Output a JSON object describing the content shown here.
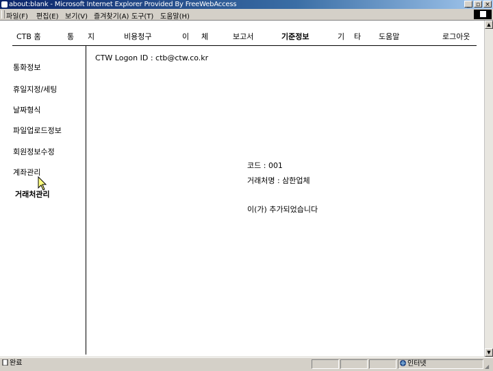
{
  "window": {
    "title": "about:blank - Microsoft Internet Explorer Provided By FreeWebAccess",
    "controls": {
      "minimize": "_",
      "maximize": "▫",
      "close": "×"
    }
  },
  "menubar": {
    "items": [
      "파일(F)",
      "편집(E)",
      "보기(V)",
      "즐겨찾기(A)",
      "도구(T)",
      "도움말(H)"
    ]
  },
  "nav": {
    "items": [
      "CTB 홈",
      "통",
      "지",
      "비용청구",
      "이",
      "체",
      "보고서",
      "기준정보",
      "기",
      "타",
      "도움말",
      "로그아웃"
    ]
  },
  "sidebar": {
    "items": [
      "통화정보",
      "휴일지정/세팅",
      "날짜형식",
      "파일업로드정보",
      "회원정보수정",
      "계좌관리",
      "거래처관리"
    ],
    "active_index": 6
  },
  "main": {
    "logon_line": "CTW Logon ID : ctb@ctw.co.kr",
    "code_line": "코드 : 001",
    "name_line": "거래처명 : 삼한업체",
    "result_line": "이(가) 추가되었습니다"
  },
  "statusbar": {
    "left": "완료",
    "zone": "인터넷"
  },
  "colors": {
    "titlebar": "#0a246a",
    "chrome": "#d4d0c8",
    "content_bg": "#ffffff",
    "text": "#000000"
  }
}
